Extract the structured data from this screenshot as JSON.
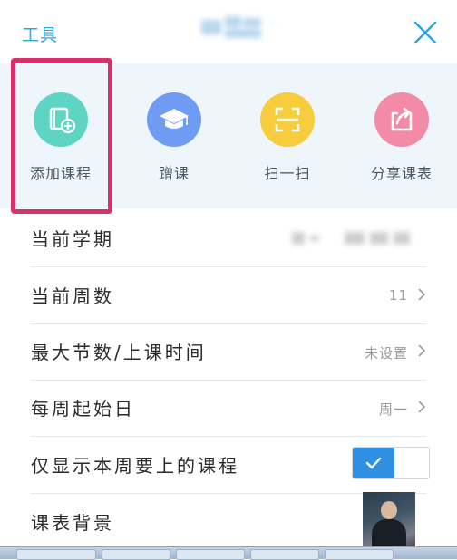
{
  "header": {
    "title": "工具",
    "close_icon": "close-icon"
  },
  "tools": [
    {
      "label": "添加课程",
      "icon": "add-course-icon",
      "color": "#5ed5c3"
    },
    {
      "label": "蹭课",
      "icon": "graduation-cap-icon",
      "color": "#6f9bf2"
    },
    {
      "label": "扫一扫",
      "icon": "scan-icon",
      "color": "#f7cc3d"
    },
    {
      "label": "分享课表",
      "icon": "share-icon",
      "color": "#f38aa6"
    }
  ],
  "settings": {
    "current_term": {
      "label": "当前学期"
    },
    "current_week": {
      "label": "当前周数",
      "value": "11"
    },
    "max_sections": {
      "label": "最大节数/上课时间",
      "value": "未设置"
    },
    "week_start": {
      "label": "每周起始日",
      "value": "周一"
    },
    "only_this_week": {
      "label": "仅显示本周要上的课程",
      "enabled": true
    },
    "schedule_bg": {
      "label": "课表背景"
    }
  },
  "colors": {
    "accent": "#2aa6e0",
    "toggle_on": "#2f8fe0",
    "highlight": "#d8306b"
  }
}
